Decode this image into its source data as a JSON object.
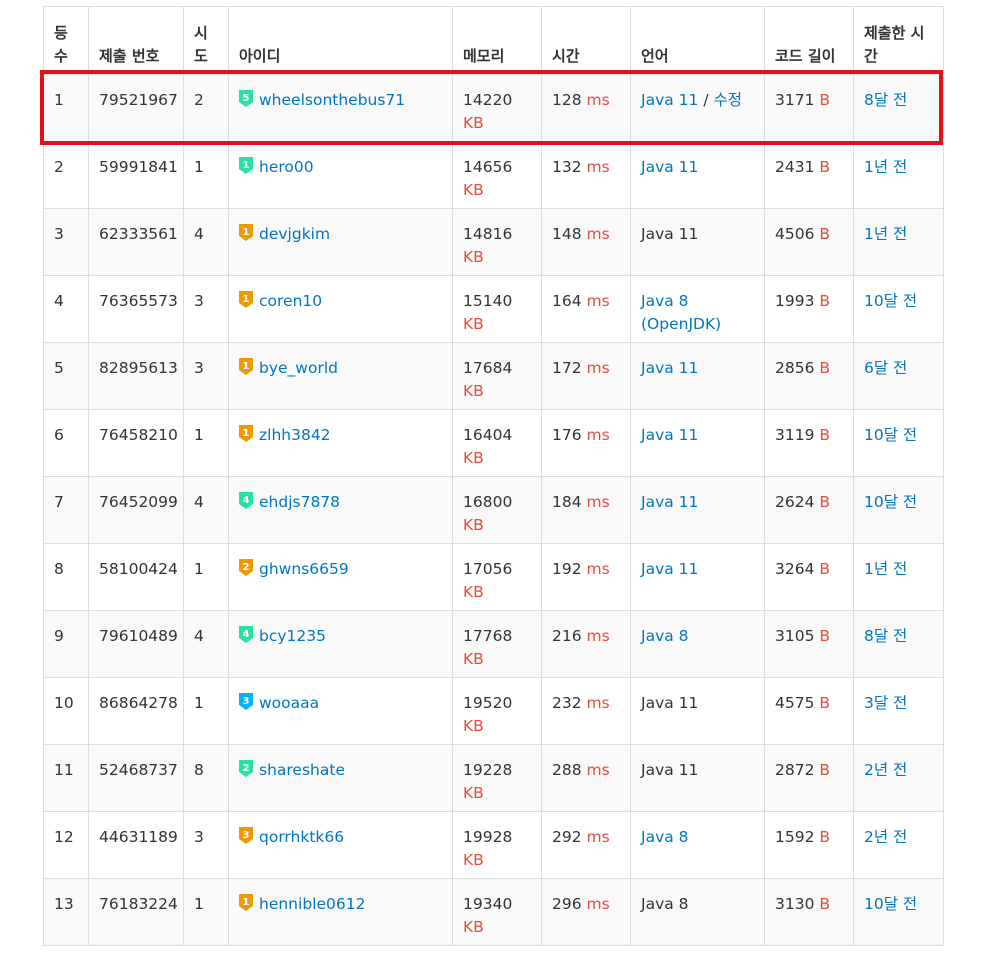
{
  "headers": {
    "rank": "등\n수",
    "submission": "제출 번호",
    "attempts": "시\n도",
    "user": "아이디",
    "memory": "메모리",
    "time": "시간",
    "language": "언어",
    "code_length": "코드 길이",
    "submitted_at": "제출한 시\n간"
  },
  "units": {
    "memory": "KB",
    "time": "ms",
    "length": "B"
  },
  "edit_label": "수정",
  "edit_separator": " / ",
  "tier_colors": {
    "gold": "#ec9a00",
    "silver": "#435f7a",
    "platinum": "#27e2a4",
    "diamond": "#00b4fc",
    "ruby": "#ff0062"
  },
  "rows": [
    {
      "rank": "1",
      "submission": "79521967",
      "attempts": "2",
      "user": "wheelsonthebus71",
      "tier_color": "platinum",
      "tier_level": "5",
      "memory": "14220",
      "time": "128",
      "language": "Java 11",
      "lang_link": true,
      "editable": true,
      "length": "3171",
      "submitted_at": "8달 전"
    },
    {
      "rank": "2",
      "submission": "59991841",
      "attempts": "1",
      "user": "hero00",
      "tier_color": "platinum",
      "tier_level": "1",
      "memory": "14656",
      "time": "132",
      "language": "Java 11",
      "lang_link": true,
      "editable": false,
      "length": "2431",
      "submitted_at": "1년 전"
    },
    {
      "rank": "3",
      "submission": "62333561",
      "attempts": "4",
      "user": "devjgkim",
      "tier_color": "gold",
      "tier_level": "1",
      "memory": "14816",
      "time": "148",
      "language": "Java 11",
      "lang_link": false,
      "editable": false,
      "length": "4506",
      "submitted_at": "1년 전"
    },
    {
      "rank": "4",
      "submission": "76365573",
      "attempts": "3",
      "user": "coren10",
      "tier_color": "gold",
      "tier_level": "1",
      "memory": "15140",
      "time": "164",
      "language": "Java 8\n(OpenJDK)",
      "lang_link": true,
      "editable": false,
      "length": "1993",
      "submitted_at": "10달 전"
    },
    {
      "rank": "5",
      "submission": "82895613",
      "attempts": "3",
      "user": "bye_world",
      "tier_color": "gold",
      "tier_level": "1",
      "memory": "17684",
      "time": "172",
      "language": "Java 11",
      "lang_link": true,
      "editable": false,
      "length": "2856",
      "submitted_at": "6달 전"
    },
    {
      "rank": "6",
      "submission": "76458210",
      "attempts": "1",
      "user": "zlhh3842",
      "tier_color": "gold",
      "tier_level": "1",
      "memory": "16404",
      "time": "176",
      "language": "Java 11",
      "lang_link": true,
      "editable": false,
      "length": "3119",
      "submitted_at": "10달 전"
    },
    {
      "rank": "7",
      "submission": "76452099",
      "attempts": "4",
      "user": "ehdjs7878",
      "tier_color": "platinum",
      "tier_level": "4",
      "memory": "16800",
      "time": "184",
      "language": "Java 11",
      "lang_link": true,
      "editable": false,
      "length": "2624",
      "submitted_at": "10달 전"
    },
    {
      "rank": "8",
      "submission": "58100424",
      "attempts": "1",
      "user": "ghwns6659",
      "tier_color": "gold",
      "tier_level": "2",
      "memory": "17056",
      "time": "192",
      "language": "Java 11",
      "lang_link": true,
      "editable": false,
      "length": "3264",
      "submitted_at": "1년 전"
    },
    {
      "rank": "9",
      "submission": "79610489",
      "attempts": "4",
      "user": "bcy1235",
      "tier_color": "platinum",
      "tier_level": "4",
      "memory": "17768",
      "time": "216",
      "language": "Java 8",
      "lang_link": true,
      "editable": false,
      "length": "3105",
      "submitted_at": "8달 전"
    },
    {
      "rank": "10",
      "submission": "86864278",
      "attempts": "1",
      "user": "wooaaa",
      "tier_color": "diamond",
      "tier_level": "3",
      "memory": "19520",
      "time": "232",
      "language": "Java 11",
      "lang_link": false,
      "editable": false,
      "length": "4575",
      "submitted_at": "3달 전"
    },
    {
      "rank": "11",
      "submission": "52468737",
      "attempts": "8",
      "user": "shareshate",
      "tier_color": "platinum",
      "tier_level": "2",
      "memory": "19228",
      "time": "288",
      "language": "Java 11",
      "lang_link": false,
      "editable": false,
      "length": "2872",
      "submitted_at": "2년 전"
    },
    {
      "rank": "12",
      "submission": "44631189",
      "attempts": "3",
      "user": "qorrhktk66",
      "tier_color": "gold",
      "tier_level": "3",
      "memory": "19928",
      "time": "292",
      "language": "Java 8",
      "lang_link": true,
      "editable": false,
      "length": "1592",
      "submitted_at": "2년 전"
    },
    {
      "rank": "13",
      "submission": "76183224",
      "attempts": "1",
      "user": "hennible0612",
      "tier_color": "gold",
      "tier_level": "1",
      "memory": "19340",
      "time": "296",
      "language": "Java 8",
      "lang_link": false,
      "editable": false,
      "length": "3130",
      "submitted_at": "10달 전"
    }
  ]
}
